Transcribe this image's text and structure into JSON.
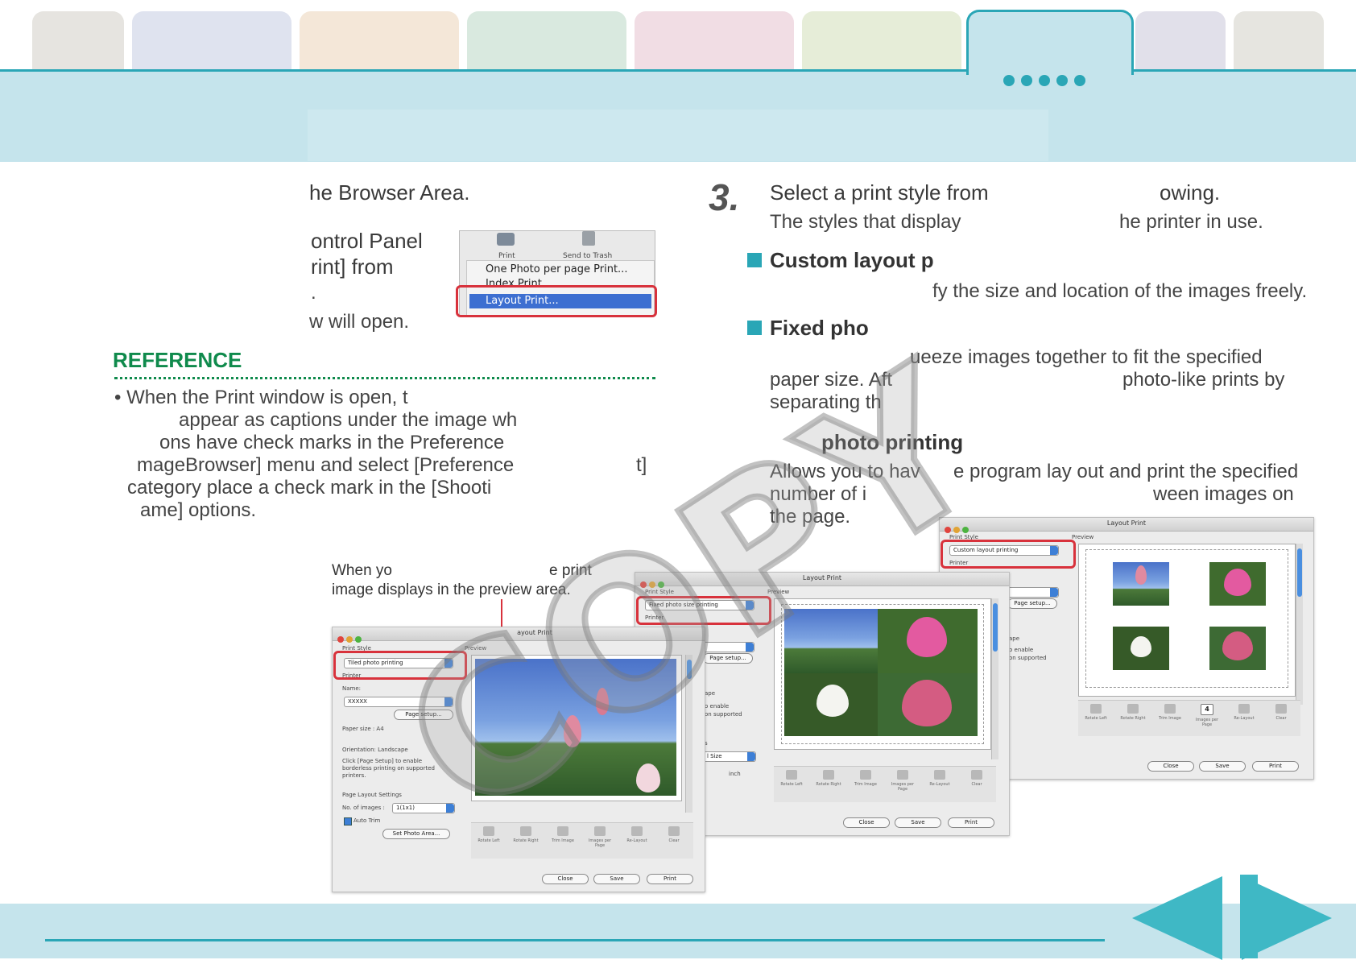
{
  "step3": {
    "number": "3.",
    "title_a": "Select a print style from",
    "title_b": "owing.",
    "sub_a": "The styles that display",
    "sub_b": "he printer in use."
  },
  "left": {
    "line1": "he Browser Area.",
    "line2": "ontrol Panel",
    "line3": "rint] from",
    "line4": ".",
    "line5": "w will open."
  },
  "menu": {
    "icon1": "Print",
    "icon2": "Send to Trash",
    "item1": "One Photo per page Print...",
    "item2": "Index Print...",
    "item3": "Layout Print..."
  },
  "reference": {
    "title": "REFERENCE",
    "lines": [
      "• When the Print window is open, t",
      "appear as captions under the image wh",
      "ons have check marks in the Preference",
      "mageBrowser] menu and select [Preference",
      "t]",
      "category place a check mark in the [Shooti",
      "ame] options."
    ]
  },
  "custom": {
    "heading": "Custom layout p",
    "desc": "fy the size and location of the images freely."
  },
  "fixed": {
    "heading": "Fixed pho",
    "desc1": "ueeze images together to fit the specified",
    "desc2a": "paper size. Aft",
    "desc2b": "photo-like prints by",
    "desc3": "separating th"
  },
  "tiled": {
    "heading": "photo printing",
    "desc1a": "Allows you to hav",
    "desc1b": "e program lay out and print the specified",
    "desc2a": "number of i",
    "desc2b": "ween images on",
    "desc3": "the page."
  },
  "caption": {
    "line1a": "When yo",
    "line1b": "e print",
    "line2": "image displays in the preview area."
  },
  "windows": {
    "title": "Layout Print",
    "title_partial": "ayout Print",
    "print_style": "Print Style",
    "preview": "Preview",
    "printer": "Printer",
    "style_tiled": "Tiled photo printing",
    "style_fixed": "Fixed photo size printing",
    "style_custom": "Custom layout printing",
    "name_label": "Name:",
    "name_value": "XXXXX",
    "page_setup": "Page setup...",
    "paper_size": "Paper size :  A4",
    "orientation": "Orientation:  Landscape",
    "click_note": "Click [Page Setup] to enable borderless printing on supported printers.",
    "layout_settings": "Page Layout Settings",
    "num_images_label": "No. of images :",
    "num_images_value": "1(1x1)",
    "auto_trim": "Auto Trim",
    "set_photo_area": "Set Photo Area...",
    "tools": [
      "Rotate Left",
      "Rotate Right",
      "Trim Image",
      "Images per Page",
      "Re-Layout",
      "Clear"
    ],
    "close": "Close",
    "save": "Save",
    "print": "Print",
    "frag_ape": "ape",
    "frag_enable": "o enable",
    "frag_supported": "on supported",
    "frag_s": "s",
    "frag_size": "l Size",
    "frag_inch": "inch",
    "images_count": "4"
  },
  "watermark": "COPY",
  "colors": {
    "accent": "#2aa6b6",
    "band": "#c5e4ec",
    "reference_green": "#0f8a4c",
    "highlight_red": "#d8323c"
  }
}
